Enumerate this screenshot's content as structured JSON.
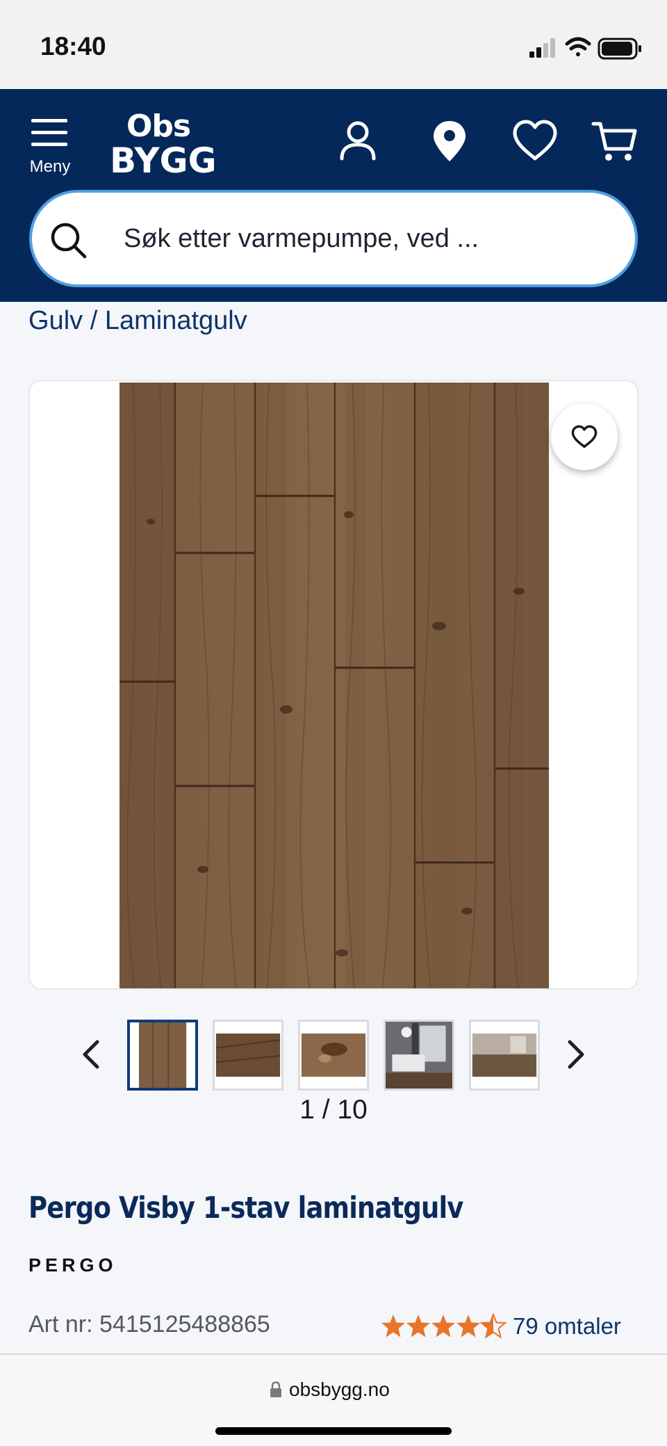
{
  "status_bar": {
    "time": "18:40"
  },
  "header": {
    "menu_label": "Meny",
    "logo_top": "Obs",
    "logo_bottom": "BYGG",
    "icons": [
      "user-icon",
      "location-pin-icon",
      "heart-icon",
      "cart-icon"
    ]
  },
  "search": {
    "placeholder": "Søk etter varmepumpe, ved ..."
  },
  "breadcrumb": {
    "items": [
      "Gulv",
      "Laminatgulv"
    ],
    "separator": " / "
  },
  "gallery": {
    "counter": "1 / 10",
    "current": 1,
    "total": 10,
    "thumbnails": [
      "thumb-plank",
      "thumb-floor-closeup",
      "thumb-floor-spill",
      "thumb-bedroom",
      "thumb-room"
    ]
  },
  "product": {
    "title": "Pergo Visby 1-stav laminatgulv",
    "brand": "PERGO",
    "art_nr": "Art nr: 5415125488865",
    "rating": 4.5,
    "reviews": "79 omtaler"
  },
  "browser": {
    "url": "obsbygg.no"
  },
  "colors": {
    "header_bg": "#04285a",
    "accent_link": "#0e3469",
    "star": "#e8742a",
    "wood": "#7d5e42"
  }
}
